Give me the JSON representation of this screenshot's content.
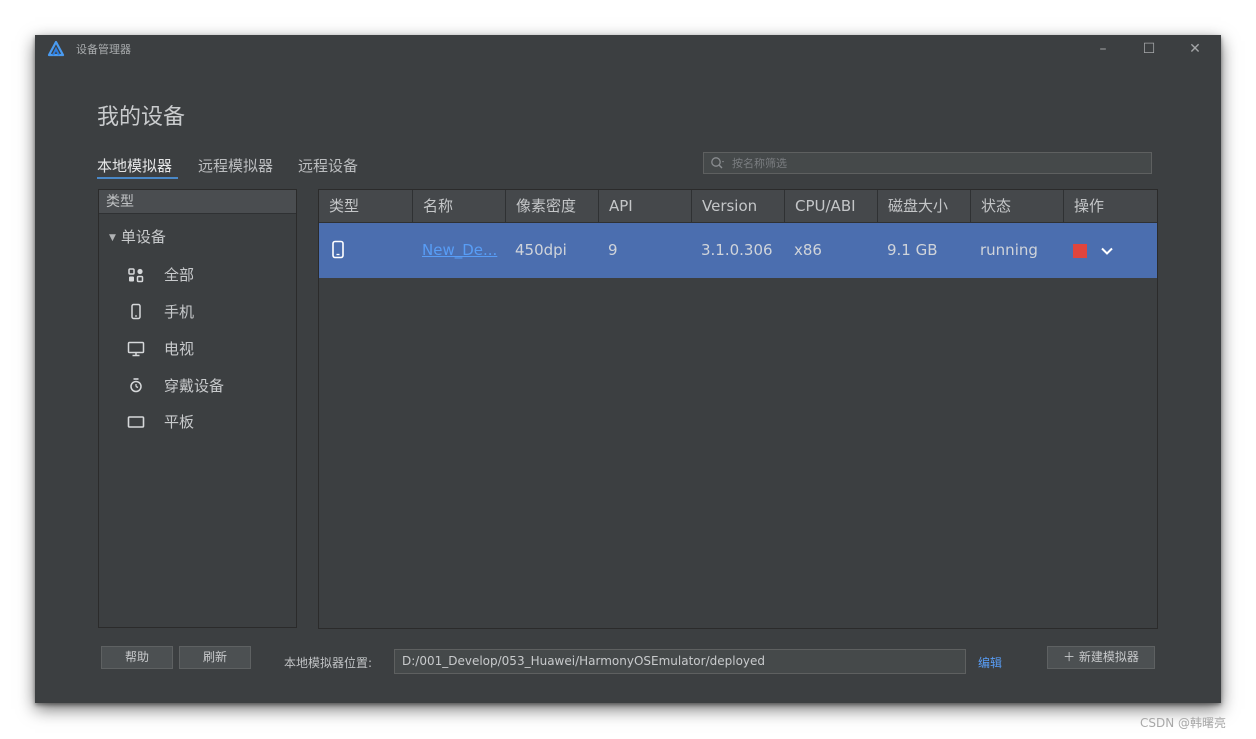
{
  "window": {
    "title": "设备管理器",
    "controls": {
      "minimize": "–",
      "maximize": "☐",
      "close": "✕"
    }
  },
  "heading": "我的设备",
  "tabs": [
    {
      "label": "本地模拟器",
      "active": true
    },
    {
      "label": "远程模拟器",
      "active": false
    },
    {
      "label": "远程设备",
      "active": false
    }
  ],
  "search": {
    "placeholder": "按名称筛选",
    "value": ""
  },
  "sidebar": {
    "header": "类型",
    "group": "单设备",
    "items": [
      {
        "label": "全部",
        "icon": "all-devices-icon"
      },
      {
        "label": "手机",
        "icon": "phone-icon"
      },
      {
        "label": "电视",
        "icon": "tv-icon"
      },
      {
        "label": "穿戴设备",
        "icon": "watch-icon"
      },
      {
        "label": "平板",
        "icon": "tablet-icon"
      }
    ]
  },
  "table": {
    "columns": [
      "类型",
      "名称",
      "像素密度",
      "API",
      "Version",
      "CPU/ABI",
      "磁盘大小",
      "状态",
      "操作"
    ],
    "rows": [
      {
        "type_icon": "phone-icon",
        "name": "New_De...",
        "density": "450dpi",
        "api": "9",
        "version": "3.1.0.306",
        "cpu": "x86",
        "disk": "9.1 GB",
        "status": "running",
        "actions": [
          "stop-icon",
          "chevron-down-icon"
        ]
      }
    ]
  },
  "footer": {
    "help": "帮助",
    "refresh": "刷新",
    "location_label": "本地模拟器位置:",
    "location_value": "D:/001_Develop/053_Huawei/HarmonyOSEmulator/deployed",
    "edit": "编辑",
    "new_emulator": "＋ 新建模拟器"
  },
  "watermark": "CSDN @韩曙亮",
  "colors": {
    "background": "#3c3f41",
    "selected_row": "#4b6eaf",
    "link": "#589df6",
    "stop": "#e0453d",
    "accent": "#4a88c7"
  }
}
